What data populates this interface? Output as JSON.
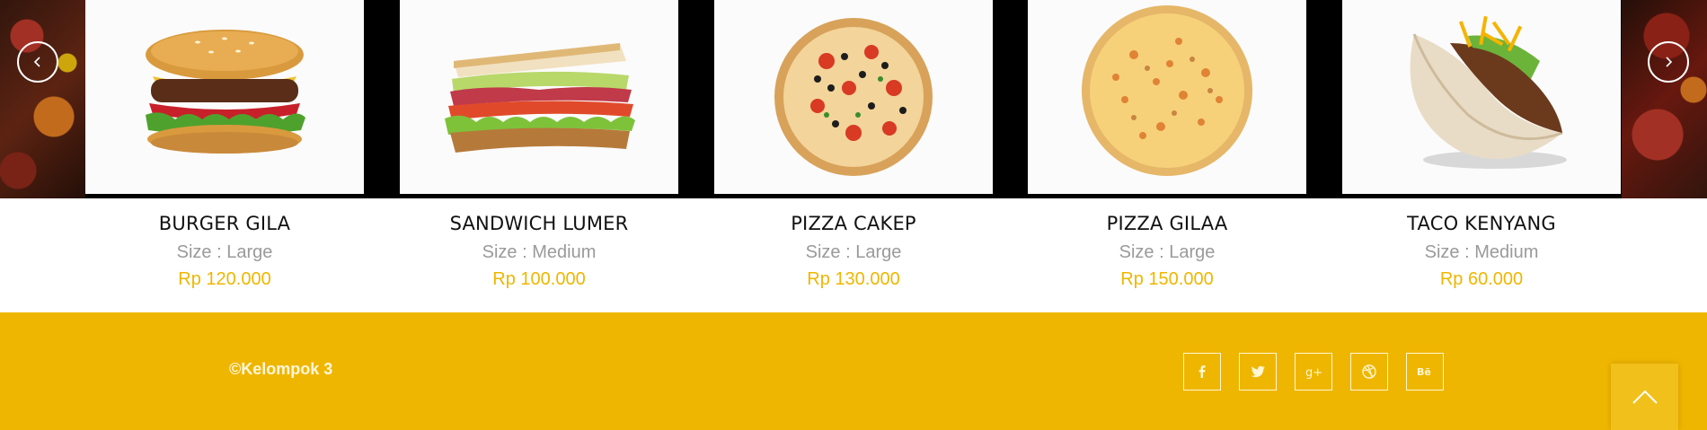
{
  "carousel": {
    "prev_icon": "chevron-left-icon",
    "next_icon": "chevron-right-icon",
    "items": [
      {
        "name": "BURGER GILA",
        "size": "Size : Large",
        "price": "Rp 120.000",
        "image": "burger"
      },
      {
        "name": "SANDWICH LUMER",
        "size": "Size : Medium",
        "price": "Rp 100.000",
        "image": "sandwich"
      },
      {
        "name": "PIZZA CAKEP",
        "size": "Size : Large",
        "price": "Rp 130.000",
        "image": "pizza-veggie"
      },
      {
        "name": "PIZZA GILAA",
        "size": "Size : Large",
        "price": "Rp 150.000",
        "image": "pizza-cheese"
      },
      {
        "name": "TACO KENYANG",
        "size": "Size : Medium",
        "price": "Rp 60.000",
        "image": "taco"
      }
    ]
  },
  "footer": {
    "copyright": "©Kelompok 3",
    "socials": [
      "facebook-icon",
      "twitter-icon",
      "google-plus-icon",
      "dribbble-icon",
      "behance-icon"
    ],
    "back_to_top_icon": "chevron-up-icon"
  },
  "colors": {
    "accent": "#efb600",
    "footer_bg": "#efb600",
    "muted_text": "#9a9a9a",
    "title_text": "#111111"
  }
}
